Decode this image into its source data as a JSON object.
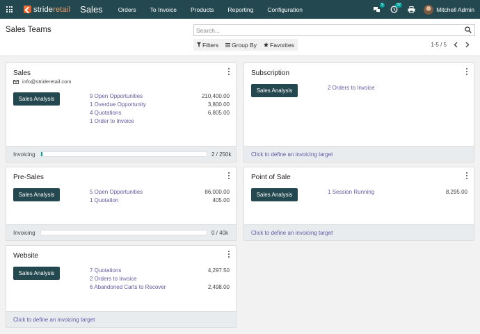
{
  "navbar": {
    "brand_prefix": "stride",
    "brand_suffix": "retail",
    "app_title": "Sales",
    "menu": [
      "Orders",
      "To Invoice",
      "Products",
      "Reporting",
      "Configuration"
    ],
    "messages_badge": "5",
    "activities_badge": "37",
    "user_name": "Mitchell Admin",
    "colors": {
      "bar": "#24484f",
      "badge": "#00a09d",
      "logo": "#e8501e"
    }
  },
  "control_panel": {
    "breadcrumb": "Sales Teams",
    "search_placeholder": "Search...",
    "filters_label": "Filters",
    "group_by_label": "Group By",
    "favorites_label": "Favorites",
    "pager_text": "1-5 / 5"
  },
  "cards": {
    "sales": {
      "title": "Sales",
      "email": "info@strideretail.com",
      "button": "Sales Analysis",
      "stats": [
        {
          "label": "9 Open Opportunities",
          "value": "210,400.00"
        },
        {
          "label": "1 Overdue Opportunity",
          "value": "3,800.00"
        },
        {
          "label": "4 Quotations",
          "value": "6,805.00"
        },
        {
          "label": "1 Order to Invoice",
          "value": ""
        }
      ],
      "footer_label": "Invoicing",
      "footer_value": "2 / 250k",
      "invoiced_fraction": 0.008
    },
    "subscription": {
      "title": "Subscription",
      "button": "Sales Analysis",
      "stats": [
        {
          "label": "2 Orders to Invoice",
          "value": ""
        }
      ],
      "footer_link": "Click to define an invoicing target"
    },
    "presales": {
      "title": "Pre-Sales",
      "button": "Sales Analysis",
      "stats": [
        {
          "label": "5 Open Opportunities",
          "value": "86,000.00"
        },
        {
          "label": "1 Quotation",
          "value": "405.00"
        }
      ],
      "footer_label": "Invoicing",
      "footer_value": "0 / 40k",
      "invoiced_fraction": 0
    },
    "pos": {
      "title": "Point of Sale",
      "button": "Sales Analysis",
      "stats": [
        {
          "label": "1 Session Running",
          "value": "8,295.00"
        }
      ],
      "footer_link": "Click to define an invoicing target"
    },
    "website": {
      "title": "Website",
      "button": "Sales Analysis",
      "stats": [
        {
          "label": "7 Quotations",
          "value": "4,297.50"
        },
        {
          "label": "2 Orders to Invoice",
          "value": ""
        },
        {
          "label": "6 Abandoned Carts to Recover",
          "value": "2,498.00"
        }
      ],
      "footer_link": "Click to define an invoicing target"
    }
  }
}
